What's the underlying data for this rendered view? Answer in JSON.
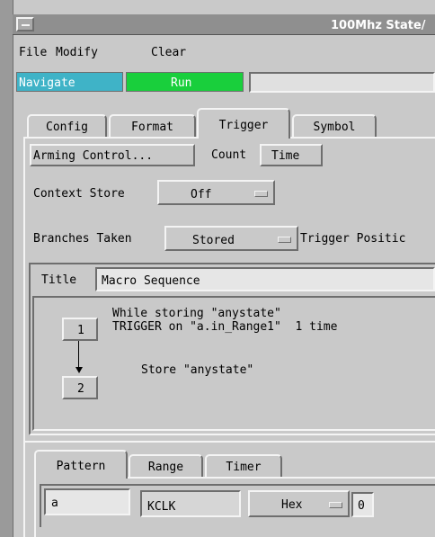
{
  "window": {
    "title": "100Mhz State/"
  },
  "menu": {
    "file": "File",
    "modify": "Modify",
    "clear": "Clear"
  },
  "toolbar": {
    "navigate": "Navigate",
    "run": "Run",
    "navigate_color": "#3fb3c7",
    "run_color": "#19cf3c"
  },
  "tabs": {
    "config": "Config",
    "format": "Format",
    "trigger": "Trigger",
    "symbol": "Symbol"
  },
  "trigger": {
    "arming_label": "Arming Control...",
    "count_label": "Count",
    "count_value": "Time",
    "context_store_label": "Context Store",
    "context_store_value": "Off",
    "branches_label": "Branches Taken",
    "branches_value": "Stored",
    "trigger_position_label": "Trigger Positic"
  },
  "sequence": {
    "title_label": "Title",
    "title_value": "Macro Sequence",
    "step1_num": "1",
    "step1_line1": "While storing \"anystate\"",
    "step1_line2": "TRIGGER on \"a.in_Range1\"  1 time",
    "step2_num": "2",
    "step2_line1": "Store \"anystate\""
  },
  "subtabs": {
    "pattern": "Pattern",
    "range": "Range",
    "timer": "Timer"
  },
  "pattern": {
    "name": "a",
    "clock": "KCLK",
    "base": "Hex",
    "value": "0"
  }
}
